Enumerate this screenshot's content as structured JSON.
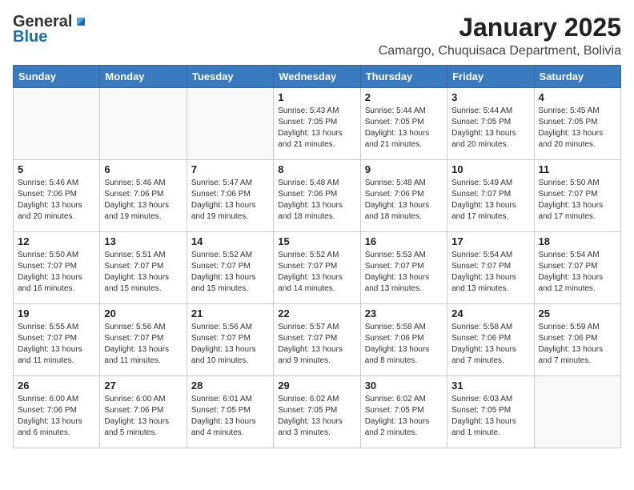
{
  "logo": {
    "general": "General",
    "blue": "Blue"
  },
  "title": {
    "month": "January 2025",
    "location": "Camargo, Chuquisaca Department, Bolivia"
  },
  "headers": [
    "Sunday",
    "Monday",
    "Tuesday",
    "Wednesday",
    "Thursday",
    "Friday",
    "Saturday"
  ],
  "weeks": [
    [
      {
        "day": "",
        "info": ""
      },
      {
        "day": "",
        "info": ""
      },
      {
        "day": "",
        "info": ""
      },
      {
        "day": "1",
        "info": "Sunrise: 5:43 AM\nSunset: 7:05 PM\nDaylight: 13 hours and 21 minutes."
      },
      {
        "day": "2",
        "info": "Sunrise: 5:44 AM\nSunset: 7:05 PM\nDaylight: 13 hours and 21 minutes."
      },
      {
        "day": "3",
        "info": "Sunrise: 5:44 AM\nSunset: 7:05 PM\nDaylight: 13 hours and 20 minutes."
      },
      {
        "day": "4",
        "info": "Sunrise: 5:45 AM\nSunset: 7:05 PM\nDaylight: 13 hours and 20 minutes."
      }
    ],
    [
      {
        "day": "5",
        "info": "Sunrise: 5:46 AM\nSunset: 7:06 PM\nDaylight: 13 hours and 20 minutes."
      },
      {
        "day": "6",
        "info": "Sunrise: 5:46 AM\nSunset: 7:06 PM\nDaylight: 13 hours and 19 minutes."
      },
      {
        "day": "7",
        "info": "Sunrise: 5:47 AM\nSunset: 7:06 PM\nDaylight: 13 hours and 19 minutes."
      },
      {
        "day": "8",
        "info": "Sunrise: 5:48 AM\nSunset: 7:06 PM\nDaylight: 13 hours and 18 minutes."
      },
      {
        "day": "9",
        "info": "Sunrise: 5:48 AM\nSunset: 7:06 PM\nDaylight: 13 hours and 18 minutes."
      },
      {
        "day": "10",
        "info": "Sunrise: 5:49 AM\nSunset: 7:07 PM\nDaylight: 13 hours and 17 minutes."
      },
      {
        "day": "11",
        "info": "Sunrise: 5:50 AM\nSunset: 7:07 PM\nDaylight: 13 hours and 17 minutes."
      }
    ],
    [
      {
        "day": "12",
        "info": "Sunrise: 5:50 AM\nSunset: 7:07 PM\nDaylight: 13 hours and 16 minutes."
      },
      {
        "day": "13",
        "info": "Sunrise: 5:51 AM\nSunset: 7:07 PM\nDaylight: 13 hours and 15 minutes."
      },
      {
        "day": "14",
        "info": "Sunrise: 5:52 AM\nSunset: 7:07 PM\nDaylight: 13 hours and 15 minutes."
      },
      {
        "day": "15",
        "info": "Sunrise: 5:52 AM\nSunset: 7:07 PM\nDaylight: 13 hours and 14 minutes."
      },
      {
        "day": "16",
        "info": "Sunrise: 5:53 AM\nSunset: 7:07 PM\nDaylight: 13 hours and 13 minutes."
      },
      {
        "day": "17",
        "info": "Sunrise: 5:54 AM\nSunset: 7:07 PM\nDaylight: 13 hours and 13 minutes."
      },
      {
        "day": "18",
        "info": "Sunrise: 5:54 AM\nSunset: 7:07 PM\nDaylight: 13 hours and 12 minutes."
      }
    ],
    [
      {
        "day": "19",
        "info": "Sunrise: 5:55 AM\nSunset: 7:07 PM\nDaylight: 13 hours and 11 minutes."
      },
      {
        "day": "20",
        "info": "Sunrise: 5:56 AM\nSunset: 7:07 PM\nDaylight: 13 hours and 11 minutes."
      },
      {
        "day": "21",
        "info": "Sunrise: 5:56 AM\nSunset: 7:07 PM\nDaylight: 13 hours and 10 minutes."
      },
      {
        "day": "22",
        "info": "Sunrise: 5:57 AM\nSunset: 7:07 PM\nDaylight: 13 hours and 9 minutes."
      },
      {
        "day": "23",
        "info": "Sunrise: 5:58 AM\nSunset: 7:06 PM\nDaylight: 13 hours and 8 minutes."
      },
      {
        "day": "24",
        "info": "Sunrise: 5:58 AM\nSunset: 7:06 PM\nDaylight: 13 hours and 7 minutes."
      },
      {
        "day": "25",
        "info": "Sunrise: 5:59 AM\nSunset: 7:06 PM\nDaylight: 13 hours and 7 minutes."
      }
    ],
    [
      {
        "day": "26",
        "info": "Sunrise: 6:00 AM\nSunset: 7:06 PM\nDaylight: 13 hours and 6 minutes."
      },
      {
        "day": "27",
        "info": "Sunrise: 6:00 AM\nSunset: 7:06 PM\nDaylight: 13 hours and 5 minutes."
      },
      {
        "day": "28",
        "info": "Sunrise: 6:01 AM\nSunset: 7:05 PM\nDaylight: 13 hours and 4 minutes."
      },
      {
        "day": "29",
        "info": "Sunrise: 6:02 AM\nSunset: 7:05 PM\nDaylight: 13 hours and 3 minutes."
      },
      {
        "day": "30",
        "info": "Sunrise: 6:02 AM\nSunset: 7:05 PM\nDaylight: 13 hours and 2 minutes."
      },
      {
        "day": "31",
        "info": "Sunrise: 6:03 AM\nSunset: 7:05 PM\nDaylight: 13 hours and 1 minute."
      },
      {
        "day": "",
        "info": ""
      }
    ]
  ]
}
